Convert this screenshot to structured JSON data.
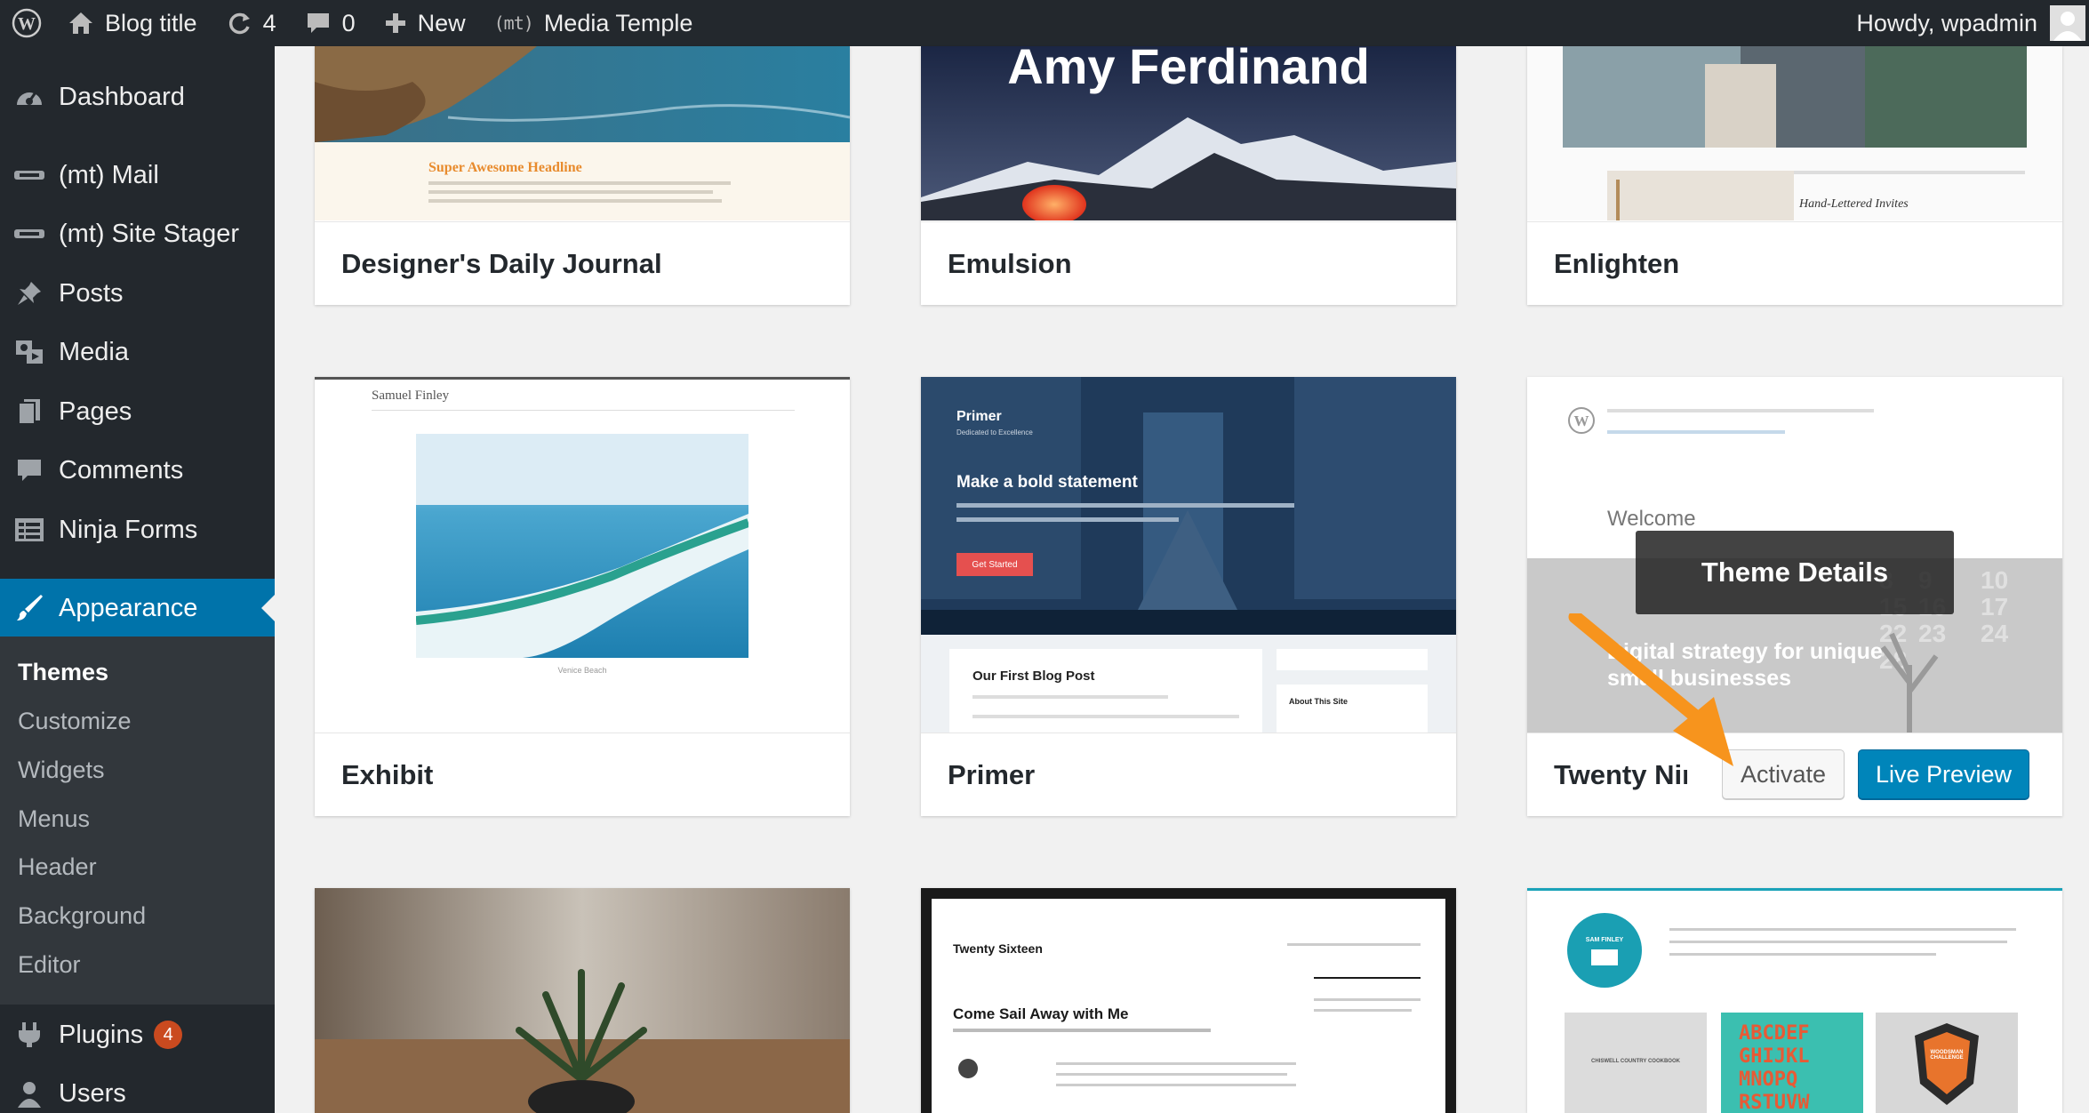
{
  "adminbar": {
    "site_title": "Blog title",
    "updates_count": "4",
    "comments_count": "0",
    "new_label": "New",
    "mt_logo": "(mt)",
    "mt_label": "Media Temple",
    "howdy": "Howdy, wpadmin"
  },
  "sidebar": {
    "items": [
      {
        "label": "Dashboard",
        "icon": "dashboard-icon"
      },
      {
        "label": "(mt) Mail",
        "icon": "mt-icon"
      },
      {
        "label": "(mt) Site Stager",
        "icon": "mt-icon"
      },
      {
        "label": "Posts",
        "icon": "pin-icon"
      },
      {
        "label": "Media",
        "icon": "media-icon"
      },
      {
        "label": "Pages",
        "icon": "pages-icon"
      },
      {
        "label": "Comments",
        "icon": "comment-icon"
      },
      {
        "label": "Ninja Forms",
        "icon": "forms-icon"
      },
      {
        "label": "Appearance",
        "icon": "brush-icon",
        "active": true
      },
      {
        "label": "Plugins",
        "icon": "plug-icon",
        "badge": "4"
      },
      {
        "label": "Users",
        "icon": "users-icon"
      }
    ],
    "submenu": [
      "Themes",
      "Customize",
      "Widgets",
      "Menus",
      "Header",
      "Background",
      "Editor"
    ]
  },
  "themes": [
    {
      "name": "Designer's Daily Journal",
      "preview_headline": "Super Awesome Headline"
    },
    {
      "name": "Emulsion",
      "preview_headline": "Amy Ferdinand"
    },
    {
      "name": "Enlighten",
      "preview_headline": "Hand-Lettered Invites"
    },
    {
      "name": "Exhibit",
      "preview_headline": "Samuel Finley",
      "preview_caption": "Venice Beach"
    },
    {
      "name": "Primer",
      "preview_headline": "Make a bold statement",
      "preview_brand": "Primer",
      "preview_tagline": "Dedicated to Excellence",
      "preview_button": "Get Started",
      "preview_post": "Our First Blog Post",
      "preview_widget": "About This Site"
    },
    {
      "name": "Twenty Nineteen",
      "preview_headline": "Welcome",
      "preview_text": "Digital strategy for unique small businesses"
    },
    {
      "name": "",
      "preview_headline": ""
    },
    {
      "name": "",
      "preview_headline": "Come Sail Away with Me",
      "preview_brand": "Twenty Sixteen"
    },
    {
      "name": "",
      "preview_headline": "SAM FINLEY",
      "preview_tiles": [
        "CHISWELL COUNTRY COOKBOOK",
        "WOODSMAN CHALLENGE"
      ]
    }
  ],
  "hover": {
    "theme_details": "Theme Details",
    "activate": "Activate",
    "live_preview": "Live Preview",
    "visible_name": "Twenty Ninet"
  },
  "colors": {
    "admin_bar": "#23282d",
    "sidebar": "#23282d",
    "submenu": "#32373c",
    "active": "#0073aa",
    "primary_button": "#0085ba",
    "badge": "#ca4a1f",
    "arrow": "#f7941d"
  }
}
